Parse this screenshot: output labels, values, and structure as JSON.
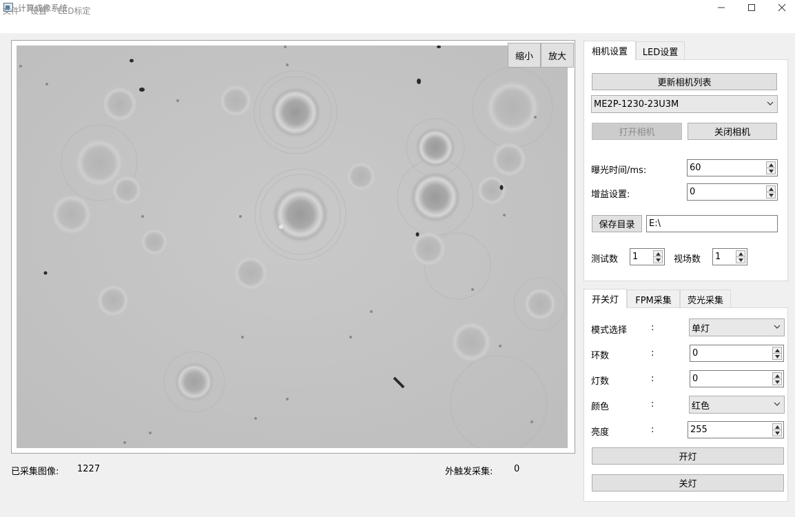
{
  "window": {
    "title": "计算成像系统",
    "minimize_label": "",
    "maximize_label": "",
    "close_label": ""
  },
  "menu": [
    "文件",
    "设置",
    "LED标定"
  ],
  "viewer": {
    "zoom_out_label": "缩小",
    "zoom_in_label": "放大"
  },
  "status": {
    "captured_label": "已采集图像:",
    "captured_value": "1227",
    "trigger_label": "外触发采集:",
    "trigger_value": "0"
  },
  "camera_tabs": [
    "相机设置",
    "LED设置"
  ],
  "camera": {
    "refresh_label": "更新相机列表",
    "model_selected": "ME2P-1230-23U3M",
    "open_label": "打开相机",
    "close_label": "关闭相机",
    "exposure_label": "曝光时间/ms:",
    "exposure_value": "60",
    "gain_label": "增益设置:",
    "gain_value": "0",
    "save_dir_label": "保存目录",
    "save_dir_value": "E:\\",
    "test_count_label": "测试数",
    "test_count_value": "1",
    "fov_count_label": "视场数",
    "fov_count_value": "1"
  },
  "led_tabs": [
    "开关灯",
    "FPM采集",
    "荧光采集"
  ],
  "led": {
    "colon": ":",
    "mode_label": "模式选择",
    "mode_value": "单灯",
    "ring_label": "环数",
    "ring_value": "0",
    "lamp_label": "灯数",
    "lamp_value": "0",
    "color_label": "颜色",
    "color_value": "红色",
    "brightness_label": "亮度",
    "brightness_value": "255",
    "on_label": "开灯",
    "off_label": "关灯"
  }
}
